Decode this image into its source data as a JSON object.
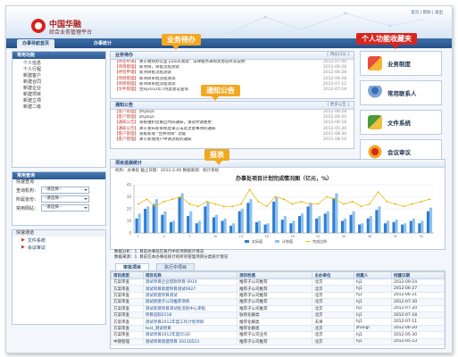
{
  "header": {
    "logo_title": "中国华融",
    "logo_subtitle": "综合业务管理平台",
    "top_links": "首页 | 帮助 | 退出"
  },
  "nav": {
    "tabs": [
      "办事导航首页",
      "办事统计"
    ]
  },
  "sidebar": {
    "personal": {
      "title": "常用功能",
      "items": [
        "个人信息",
        "个人行程",
        "新建客户",
        "新建合同",
        "新建企业",
        "新建项目",
        "新建立项",
        "新建二级"
      ]
    },
    "query": {
      "title": "常用查询",
      "subtitle": "快速查询",
      "fields": [
        {
          "label": "查询机构：",
          "value": "--请选择--"
        },
        {
          "label": "所属省份：",
          "value": "--请选择--"
        },
        {
          "label": "常用网站：",
          "value": "--请选择--"
        }
      ]
    },
    "links": {
      "title": "快速通道",
      "items": [
        "文件系统",
        "会议审议"
      ]
    }
  },
  "todo": {
    "title": "业务待办",
    "more": "[ 待办(33) ]",
    "rows": [
      {
        "tag": "【待签申请】",
        "text": "关于收购办公室 yuxuli测试：法律服务采购及协议补充说明",
        "date": "2012-07-06"
      },
      {
        "tag": "【项目管理】",
        "text": "新项目，审批流程测试",
        "date": "2012-06-28"
      },
      {
        "tag": "【待签申请】",
        "text": "新项目批流程测试",
        "date": "2012-06-28"
      },
      {
        "tag": "【项目管理】",
        "text": "新项目审批流程测试",
        "date": "2012-06-28"
      },
      {
        "tag": "【项目管理】",
        "text": "新项目审批流程测试",
        "date": "2012-07-12"
      },
      {
        "tag": "【文件管理】",
        "text": "合同2012年7月度会议查询",
        "date": "2012-07-18"
      }
    ]
  },
  "notice": {
    "title": "通知公告",
    "more": "[ 更多公告 ]",
    "rows": [
      {
        "tag": "【客户管理】",
        "text": "zhyzuzi",
        "date": "2012-06-28"
      },
      {
        "tag": "【客户管理】",
        "text": "zhyzuzi",
        "date": "2012-06-20"
      },
      {
        "tag": "【通知公告】",
        "text": "系统维护后重启时间通知，请及时调整更",
        "date": "2012-06-18"
      },
      {
        "tag": "【通知公告】",
        "text": "关于发布新系统登录方法及注意事项的通知",
        "date": "2012-05-30"
      },
      {
        "tag": "【客户管理】",
        "text": "系统新增 \"合并项目\" 功能",
        "date": "2011-08-30"
      },
      {
        "tag": "【客户管理】",
        "text": "关于新增用户申请流程的通知",
        "date": "2011-08-10"
      }
    ]
  },
  "favorites": {
    "items": [
      "业务制度",
      "常用联系人",
      "文件系统",
      "会议审议"
    ]
  },
  "report": {
    "section_title": "项目进展统计",
    "meta": "机构：办事处          截止日期：2012-2-06          数据来源：统计系统",
    "legend": [
      "实际值",
      "计划值",
      "完成比例"
    ]
  },
  "chart_data": {
    "type": "bar",
    "title": "办事处项目计划完成情况图（亿元，%）",
    "legend": [
      "实际值",
      "计划值",
      "完成比例"
    ],
    "categories": [
      "1",
      "2",
      "3",
      "4",
      "5",
      "6",
      "7",
      "8",
      "9",
      "10",
      "11",
      "12",
      "13",
      "14",
      "15",
      "16",
      "17",
      "18",
      "19",
      "20",
      "21",
      "22",
      "23",
      "24",
      "25",
      "26",
      "27",
      "28",
      "29",
      "30",
      "31",
      "32",
      "33",
      "34",
      "35"
    ],
    "series": [
      {
        "name": "实际值",
        "values": [
          12,
          20,
          24,
          15,
          9,
          30,
          14,
          8,
          22,
          13,
          10,
          6,
          18,
          25,
          9,
          7,
          26,
          11,
          8,
          14,
          22,
          12,
          16,
          29,
          10,
          15,
          7,
          12,
          19,
          8,
          9,
          7,
          10,
          8,
          18
        ]
      },
      {
        "name": "计划值",
        "values": [
          16,
          22,
          28,
          18,
          10,
          33,
          18,
          10,
          26,
          15,
          12,
          8,
          20,
          28,
          10,
          8,
          30,
          14,
          10,
          16,
          25,
          14,
          18,
          33,
          12,
          18,
          8,
          14,
          22,
          10,
          11,
          8,
          12,
          10,
          21
        ]
      },
      {
        "name": "完成比例",
        "values": [
          24,
          28,
          22,
          26,
          28,
          30,
          24,
          22,
          26,
          24,
          22,
          22,
          24,
          36,
          26,
          22,
          30,
          28,
          24,
          26,
          24,
          24,
          30,
          28,
          24,
          26,
          22,
          24,
          34,
          26,
          24,
          22,
          24,
          26,
          28
        ]
      }
    ],
    "ylim": [
      0,
      40
    ],
    "yticks": [
      0,
      10,
      20,
      30,
      40
    ],
    "grid": true
  },
  "analysis": {
    "tabs": [
      "审批项目",
      "执行中项目"
    ],
    "line1": "数据分析：1. 目前办事处在执行中的项目统计情况",
    "line2": "数据来源：1. 目前在本办事处统计的所有管理项目分类统计情况"
  },
  "projects": {
    "columns": [
      "项目类型",
      "项目名称",
      "项目性质",
      "主办单位",
      "创建人",
      "创建日期"
    ],
    "rows": [
      [
        "方案审查",
        "测试项目企业借款项目 0914",
        "推荐子公司推荐",
        "北京",
        "hj1",
        "2012-09-14"
      ],
      [
        "方案审查",
        "测试项目新建项目测试0627",
        "推荐子公司推荐",
        "北京",
        "hj1",
        "2012-06-27"
      ],
      [
        "方案审查",
        "测试新建项目测试",
        "推荐子公司推荐",
        "北京",
        "hj1",
        "2012-06-21"
      ],
      [
        "方案审查",
        "测试新建子公司推荐项目",
        "推荐子公司推荐",
        "北京",
        "hj1",
        "2012-07-30"
      ],
      [
        "方案审查",
        "测试新建项目测试批流程中心审批",
        "推荐子公司推荐",
        "北京",
        "hj1",
        "2012-07-20"
      ],
      [
        "方案审查",
        "项目追踪0118",
        "收购化解类",
        "北京",
        "hj1",
        "2012-07-18"
      ],
      [
        "方案审查",
        "测试项目2012年度工作计划项目",
        "推荐化解类",
        "天津",
        "hj1",
        "2012-07-11"
      ],
      [
        "方案审查",
        "test_测试项目",
        "推荐化解类",
        "北京",
        "zhangl",
        "2012-06-20"
      ],
      [
        "方案审查",
        "测试项目2012年度0530",
        "推荐子公司业务",
        "北京",
        "hj1",
        "2012-05-30"
      ],
      [
        "中期管理",
        "测试项目新建项目 20110523",
        "推荐子公司推荐",
        "北京",
        "hj1",
        "2012-05-23"
      ]
    ]
  },
  "callouts": {
    "todo": "业务待办",
    "notice": "通知公告",
    "report": "报表",
    "favorites": "个人功能收藏夹"
  }
}
